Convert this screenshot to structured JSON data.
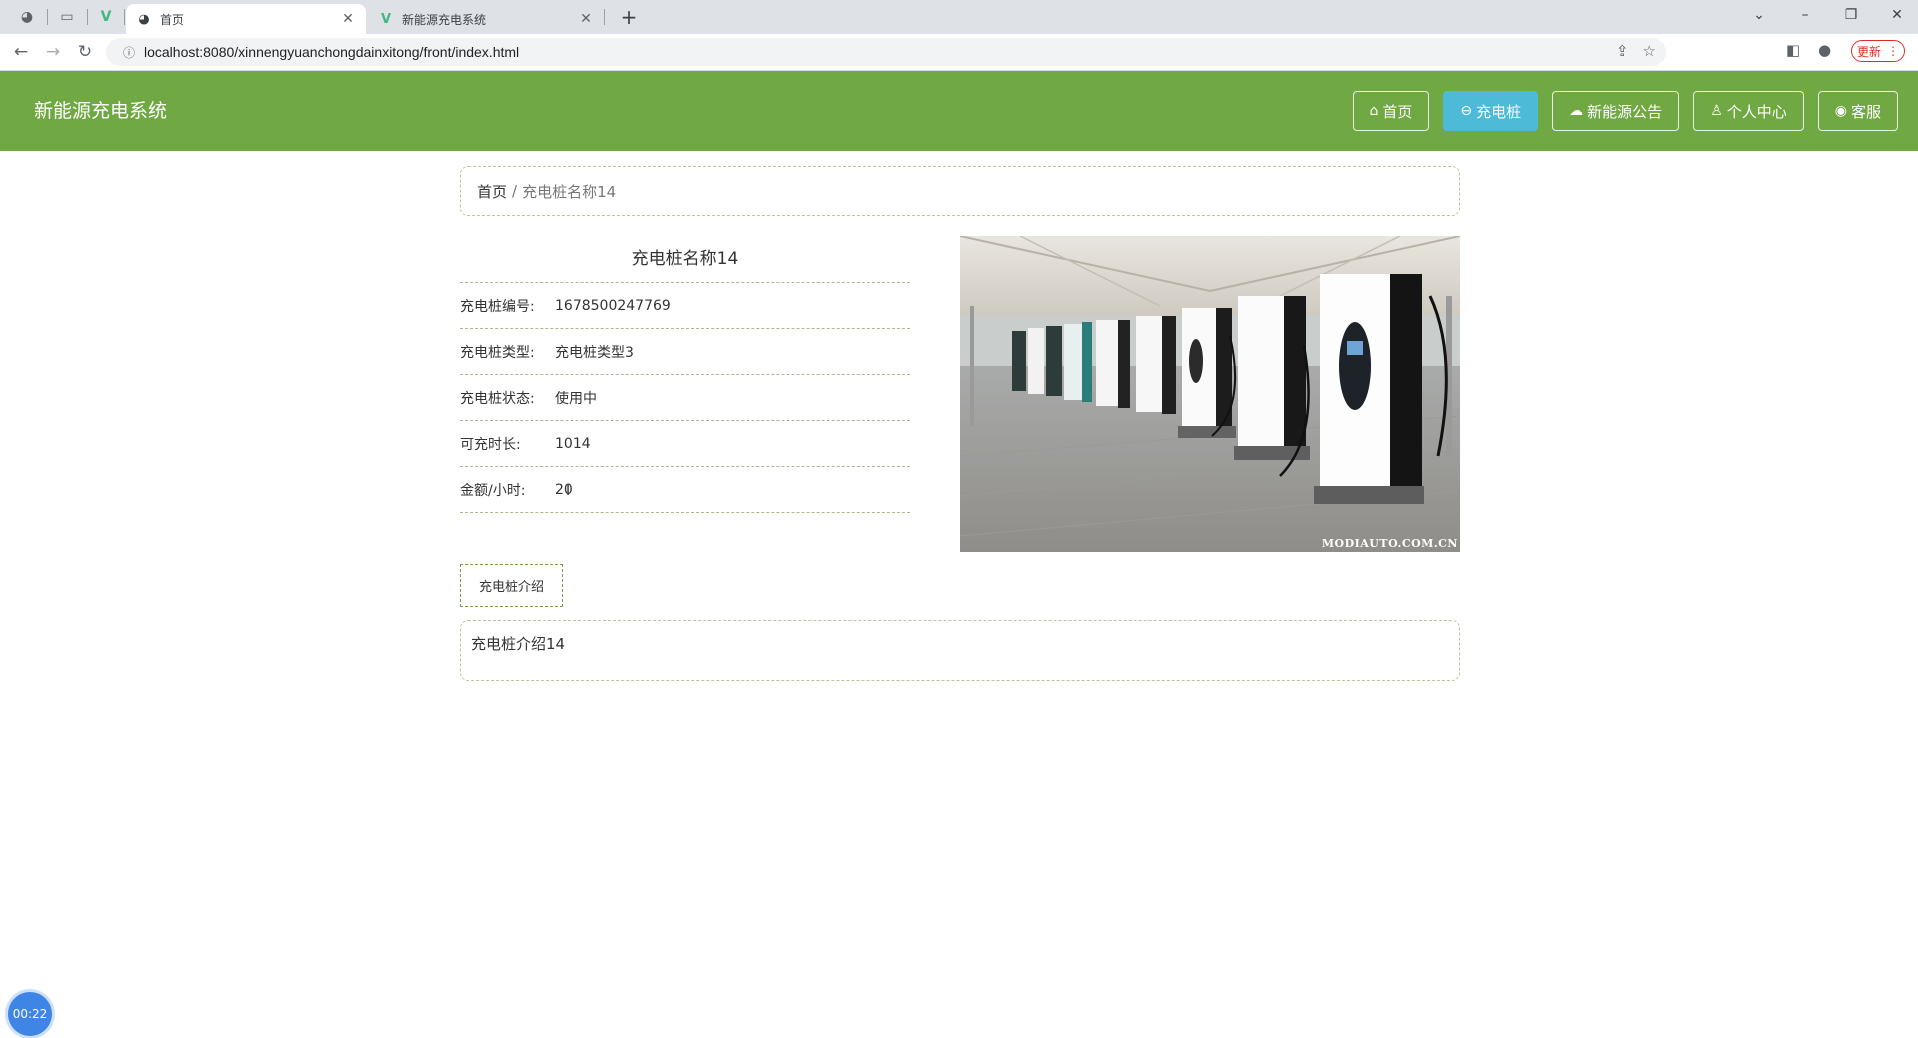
{
  "browser": {
    "tabs": [
      {
        "icon": "globe-icon",
        "title": "首页",
        "active": true
      },
      {
        "icon": "vue-icon",
        "title": "新能源充电系统",
        "active": false
      }
    ],
    "close_glyph": "✕",
    "new_tab_glyph": "+",
    "url": "localhost:8080/xinnengyuanchongdainxitong/front/index.html",
    "update_label": "更新"
  },
  "site": {
    "brand": "新能源充电系统",
    "nav": [
      {
        "icon": "home-outline-icon",
        "label": "首页",
        "active": false
      },
      {
        "icon": "charger-icon",
        "label": "充电桩",
        "active": true
      },
      {
        "icon": "cloud-icon",
        "label": "新能源公告",
        "active": false
      },
      {
        "icon": "user-icon",
        "label": "个人中心",
        "active": false
      },
      {
        "icon": "chat-icon",
        "label": "客服",
        "active": false
      }
    ]
  },
  "breadcrumb": {
    "home": "首页",
    "separator": "/",
    "current": "充电桩名称14"
  },
  "detail": {
    "title": "充电桩名称14",
    "fields": [
      {
        "label": "充电桩编号:",
        "value": "1678500247769"
      },
      {
        "label": "充电桩类型:",
        "value": "充电桩类型3"
      },
      {
        "label": "充电桩状态:",
        "value": "使用中"
      },
      {
        "label": "可充时长:",
        "value": "1014"
      },
      {
        "label": "金额/小时:",
        "value": "20"
      }
    ],
    "image_watermark": "MODIAUTO.COM.CN"
  },
  "intro": {
    "tab_label": "充电桩介绍",
    "content": "充电桩介绍14"
  },
  "timer": "00:22",
  "colors": {
    "header_green": "#70a844",
    "active_nav": "#4dbad8",
    "timer_blue": "#3f85e6"
  }
}
